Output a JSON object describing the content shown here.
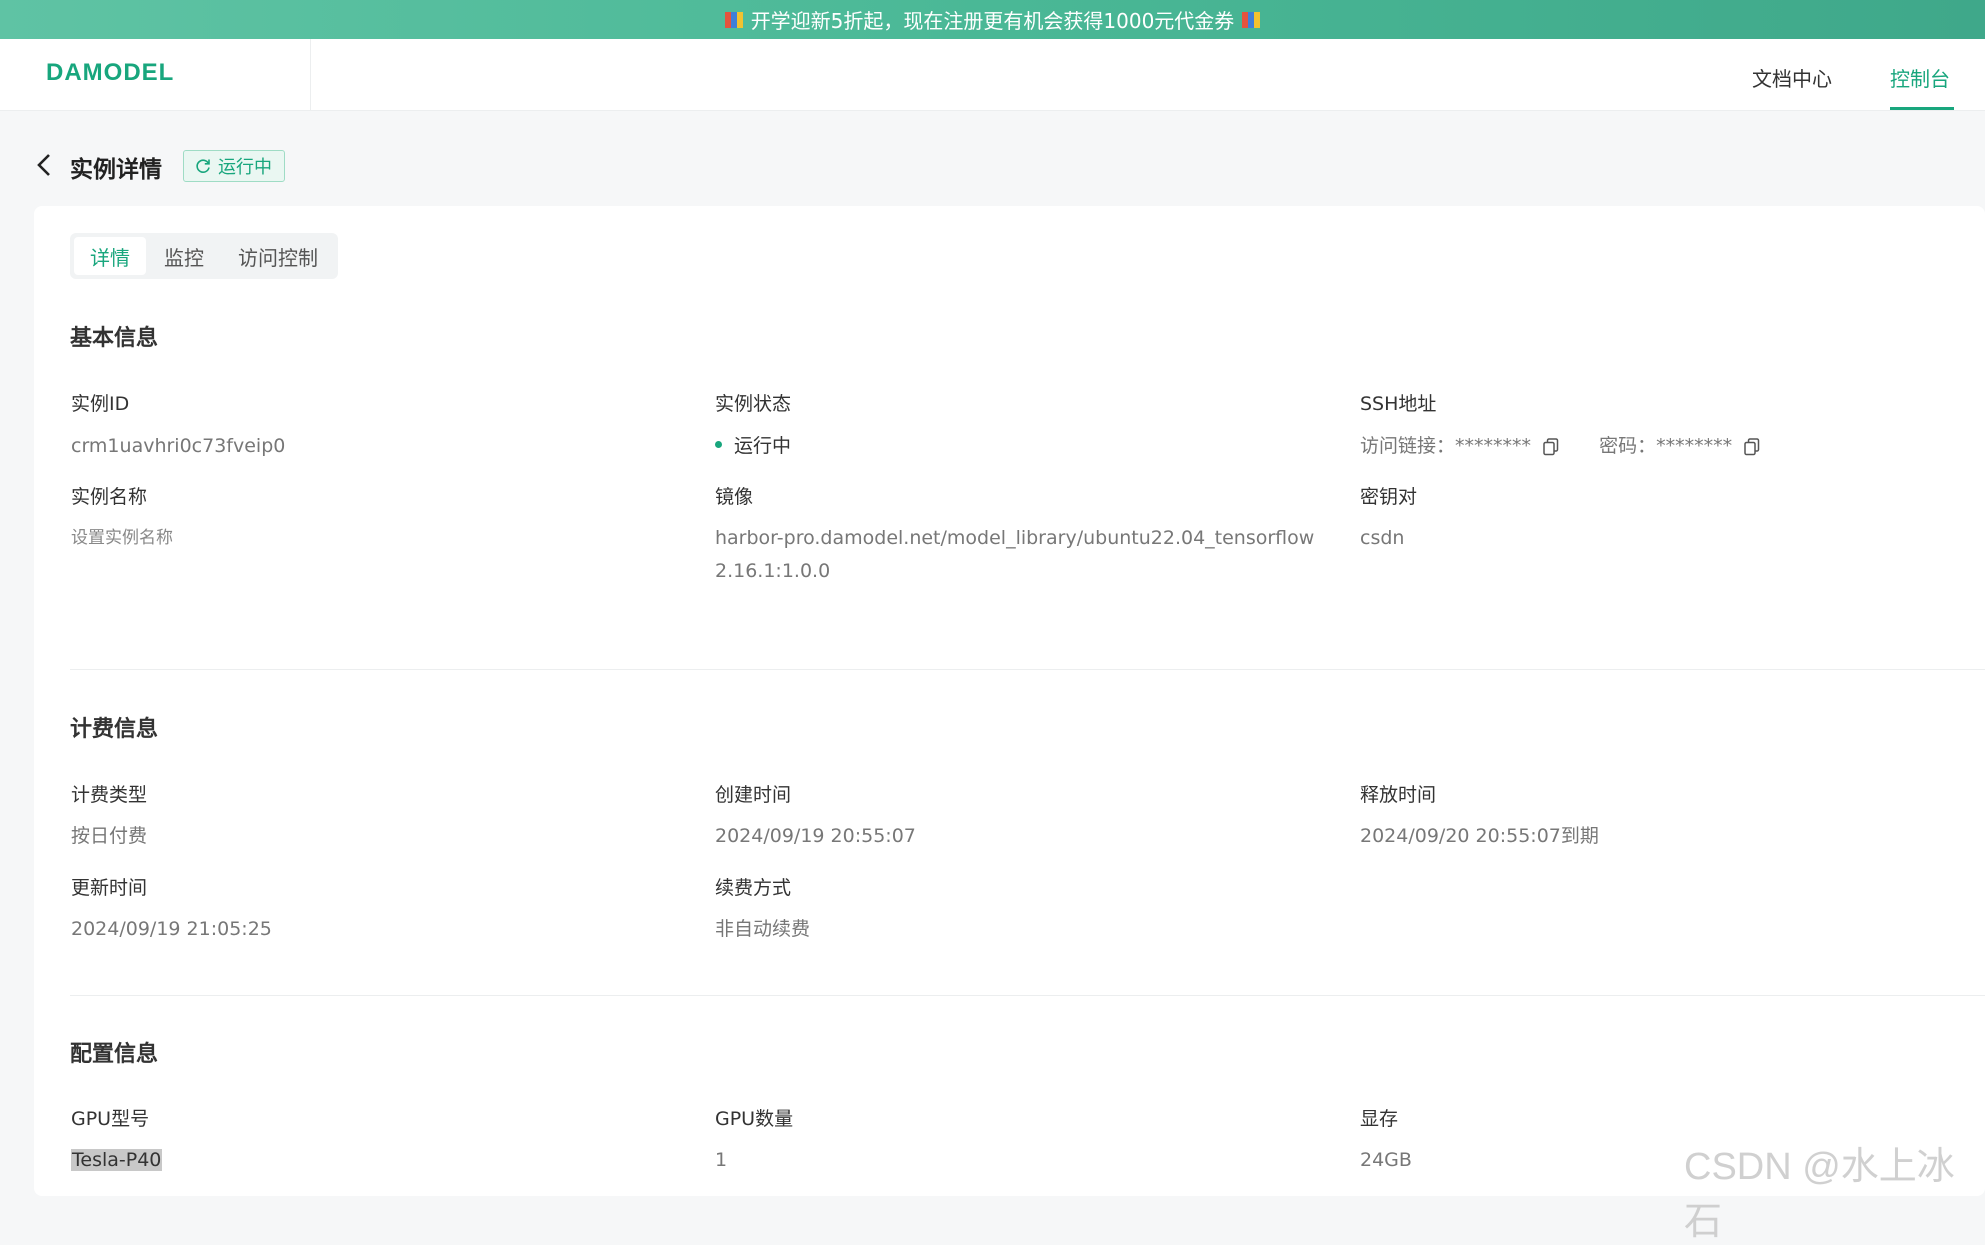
{
  "banner": {
    "text": "开学迎新5折起，现在注册更有机会获得1000元代金券"
  },
  "header": {
    "logo": "DAMODEL",
    "nav": {
      "docs": "文档中心",
      "console": "控制台"
    }
  },
  "page": {
    "title": "实例详情",
    "status_badge": "运行中",
    "tabs": [
      "详情",
      "监控",
      "访问控制"
    ]
  },
  "basic": {
    "title": "基本信息",
    "instance_id_label": "实例ID",
    "instance_id": "crm1uavhri0c73fveip0",
    "status_label": "实例状态",
    "status": "运行中",
    "ssh_label": "SSH地址",
    "ssh_link_label": "访问链接：",
    "ssh_link_value": "********",
    "ssh_pwd_label": "密码：",
    "ssh_pwd_value": "********",
    "name_label": "实例名称",
    "name_placeholder": "设置实例名称",
    "image_label": "镜像",
    "image": "harbor-pro.damodel.net/model_library/ubuntu22.04_tensorflow2.16.1:1.0.0",
    "keypair_label": "密钥对",
    "keypair": "csdn"
  },
  "billing": {
    "title": "计费信息",
    "type_label": "计费类型",
    "type": "按日付费",
    "created_label": "创建时间",
    "created": "2024/09/19 20:55:07",
    "release_label": "释放时间",
    "release": "2024/09/20 20:55:07到期",
    "updated_label": "更新时间",
    "updated": "2024/09/19 21:05:25",
    "renew_label": "续费方式",
    "renew": "非自动续费"
  },
  "config": {
    "title": "配置信息",
    "gpu_model_label": "GPU型号",
    "gpu_model": "Tesla-P40",
    "gpu_count_label": "GPU数量",
    "gpu_count": "1",
    "vram_label": "显存",
    "vram": "24GB"
  },
  "watermark": "CSDN @水上冰石",
  "colors": {
    "accent": "#18a67d",
    "banner": "#4ab896"
  }
}
